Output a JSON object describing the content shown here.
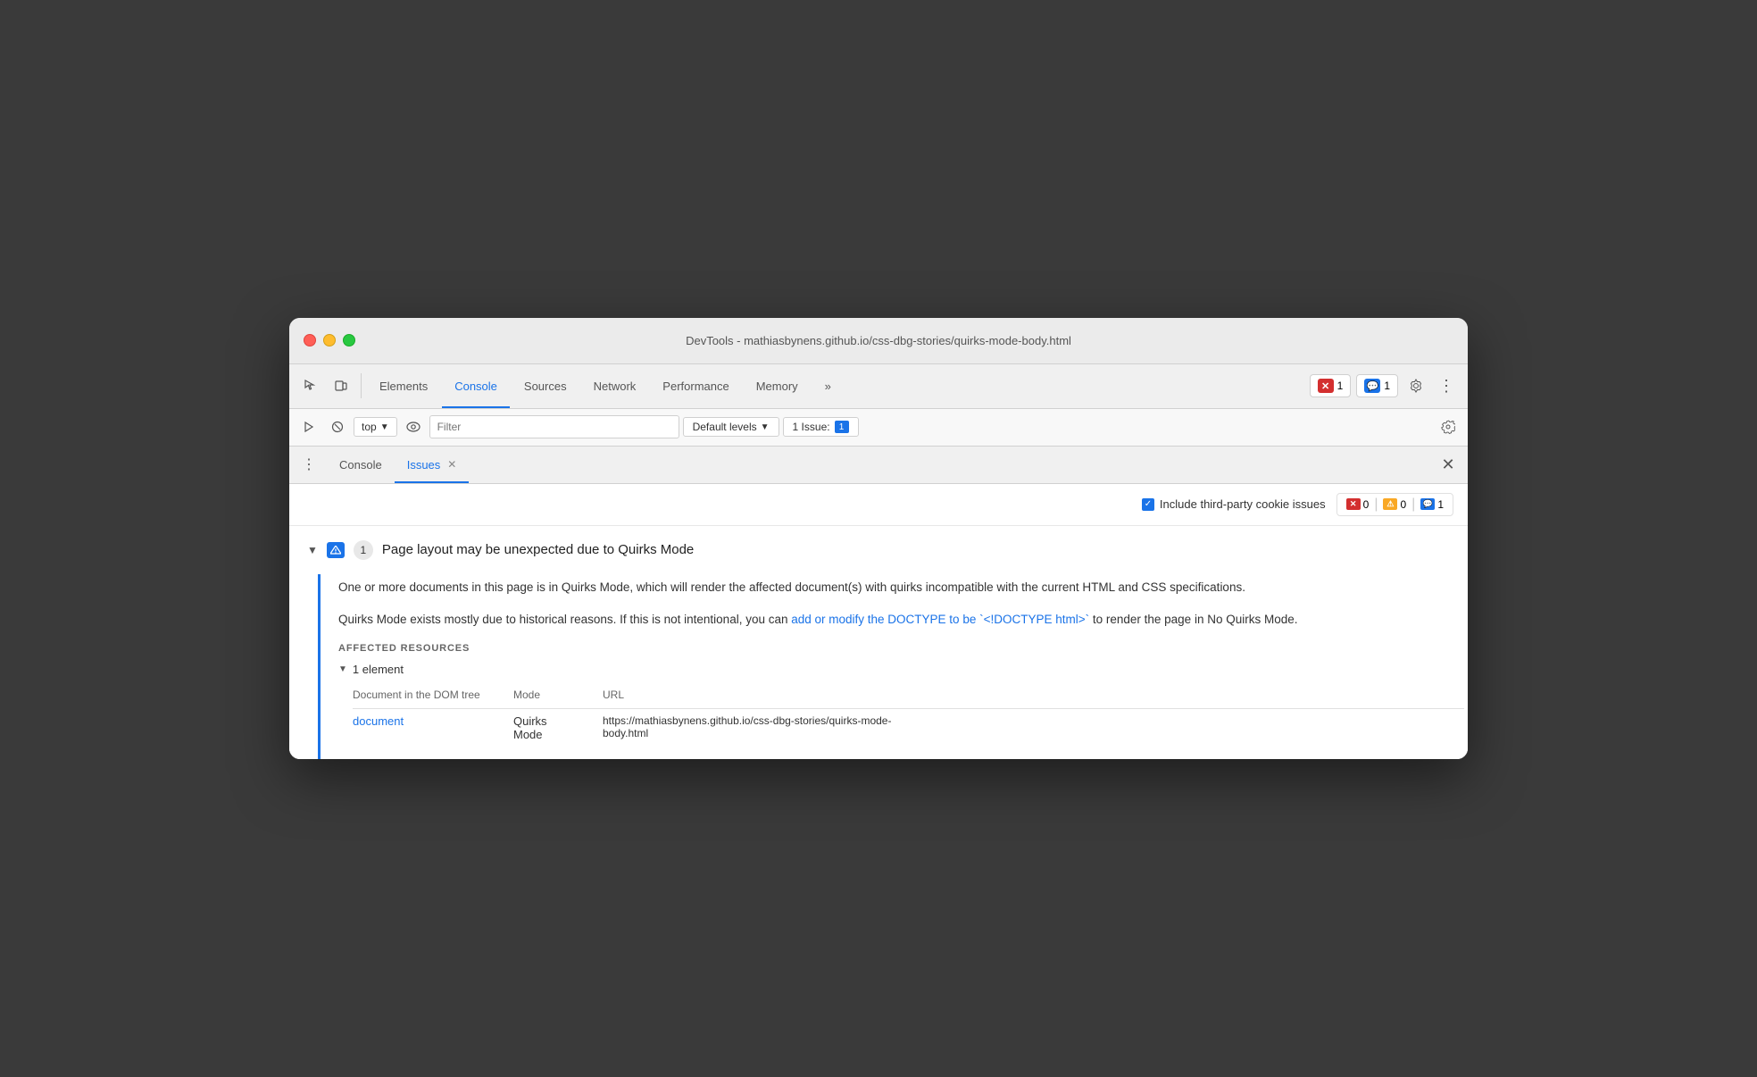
{
  "window": {
    "title": "DevTools - mathiasbynens.github.io/css-dbg-stories/quirks-mode-body.html"
  },
  "toolbar": {
    "tabs": [
      {
        "id": "elements",
        "label": "Elements",
        "active": false
      },
      {
        "id": "console",
        "label": "Console",
        "active": true
      },
      {
        "id": "sources",
        "label": "Sources",
        "active": false
      },
      {
        "id": "network",
        "label": "Network",
        "active": false
      },
      {
        "id": "performance",
        "label": "Performance",
        "active": false
      },
      {
        "id": "memory",
        "label": "Memory",
        "active": false
      }
    ],
    "more_label": "»",
    "error_count": "1",
    "message_count": "1"
  },
  "console_toolbar": {
    "top_label": "top",
    "filter_placeholder": "Filter",
    "default_levels_label": "Default levels",
    "issues_label": "1 Issue:",
    "issues_count": "1"
  },
  "drawer": {
    "tabs": [
      {
        "id": "console",
        "label": "Console",
        "has_close": false,
        "active": false
      },
      {
        "id": "issues",
        "label": "Issues",
        "has_close": true,
        "active": true
      }
    ]
  },
  "issues_panel": {
    "include_third_party": "Include third-party cookie issues",
    "error_count": "0",
    "warning_count": "0",
    "info_count": "1",
    "issue": {
      "title": "Page layout may be unexpected due to Quirks Mode",
      "count": "1",
      "description_1": "One or more documents in this page is in Quirks Mode, which will render the affected document(s) with quirks incompatible with the current HTML and CSS specifications.",
      "description_2_before": "Quirks Mode exists mostly due to historical reasons. If this is not intentional, you can ",
      "description_2_link": "add or modify the DOCTYPE to be `<!DOCTYPE html>`",
      "description_2_after": " to render the page in No Quirks Mode.",
      "affected_label": "AFFECTED RESOURCES",
      "element_count": "1 element",
      "table": {
        "col1": "Document in the DOM tree",
        "col2": "Mode",
        "col3": "URL",
        "row_link": "document",
        "row_mode": "Quirks Mode",
        "row_url": "https://mathiasbynens.github.io/css-dbg-stories/quirks-mode-body.html"
      }
    }
  }
}
